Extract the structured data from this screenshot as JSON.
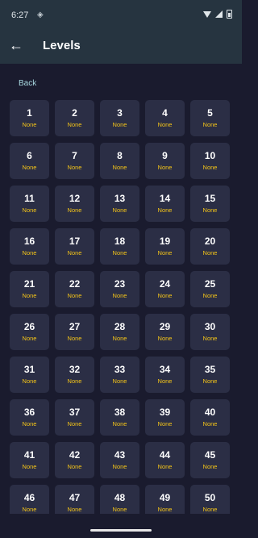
{
  "status_bar": {
    "time": "6:27",
    "indicator": "◈"
  },
  "app_bar": {
    "title": "Levels",
    "back_icon": "arrow-left-icon"
  },
  "back_link": {
    "label": "Back"
  },
  "levels": [
    {
      "number": "1",
      "status": "None"
    },
    {
      "number": "2",
      "status": "None"
    },
    {
      "number": "3",
      "status": "None"
    },
    {
      "number": "4",
      "status": "None"
    },
    {
      "number": "5",
      "status": "None"
    },
    {
      "number": "6",
      "status": "None"
    },
    {
      "number": "7",
      "status": "None"
    },
    {
      "number": "8",
      "status": "None"
    },
    {
      "number": "9",
      "status": "None"
    },
    {
      "number": "10",
      "status": "None"
    },
    {
      "number": "11",
      "status": "None"
    },
    {
      "number": "12",
      "status": "None"
    },
    {
      "number": "13",
      "status": "None"
    },
    {
      "number": "14",
      "status": "None"
    },
    {
      "number": "15",
      "status": "None"
    },
    {
      "number": "16",
      "status": "None"
    },
    {
      "number": "17",
      "status": "None"
    },
    {
      "number": "18",
      "status": "None"
    },
    {
      "number": "19",
      "status": "None"
    },
    {
      "number": "20",
      "status": "None"
    },
    {
      "number": "21",
      "status": "None"
    },
    {
      "number": "22",
      "status": "None"
    },
    {
      "number": "23",
      "status": "None"
    },
    {
      "number": "24",
      "status": "None"
    },
    {
      "number": "25",
      "status": "None"
    },
    {
      "number": "26",
      "status": "None"
    },
    {
      "number": "27",
      "status": "None"
    },
    {
      "number": "28",
      "status": "None"
    },
    {
      "number": "29",
      "status": "None"
    },
    {
      "number": "30",
      "status": "None"
    },
    {
      "number": "31",
      "status": "None"
    },
    {
      "number": "32",
      "status": "None"
    },
    {
      "number": "33",
      "status": "None"
    },
    {
      "number": "34",
      "status": "None"
    },
    {
      "number": "35",
      "status": "None"
    },
    {
      "number": "36",
      "status": "None"
    },
    {
      "number": "37",
      "status": "None"
    },
    {
      "number": "38",
      "status": "None"
    },
    {
      "number": "39",
      "status": "None"
    },
    {
      "number": "40",
      "status": "None"
    },
    {
      "number": "41",
      "status": "None"
    },
    {
      "number": "42",
      "status": "None"
    },
    {
      "number": "43",
      "status": "None"
    },
    {
      "number": "44",
      "status": "None"
    },
    {
      "number": "45",
      "status": "None"
    },
    {
      "number": "46",
      "status": "None"
    },
    {
      "number": "47",
      "status": "None"
    },
    {
      "number": "48",
      "status": "None"
    },
    {
      "number": "49",
      "status": "None"
    },
    {
      "number": "50",
      "status": "None"
    }
  ],
  "colors": {
    "background": "#1a1b2e",
    "app_bar": "#263440",
    "tile": "#2b2e45",
    "status_text": "#f5c518",
    "link": "#a8d8e0"
  }
}
